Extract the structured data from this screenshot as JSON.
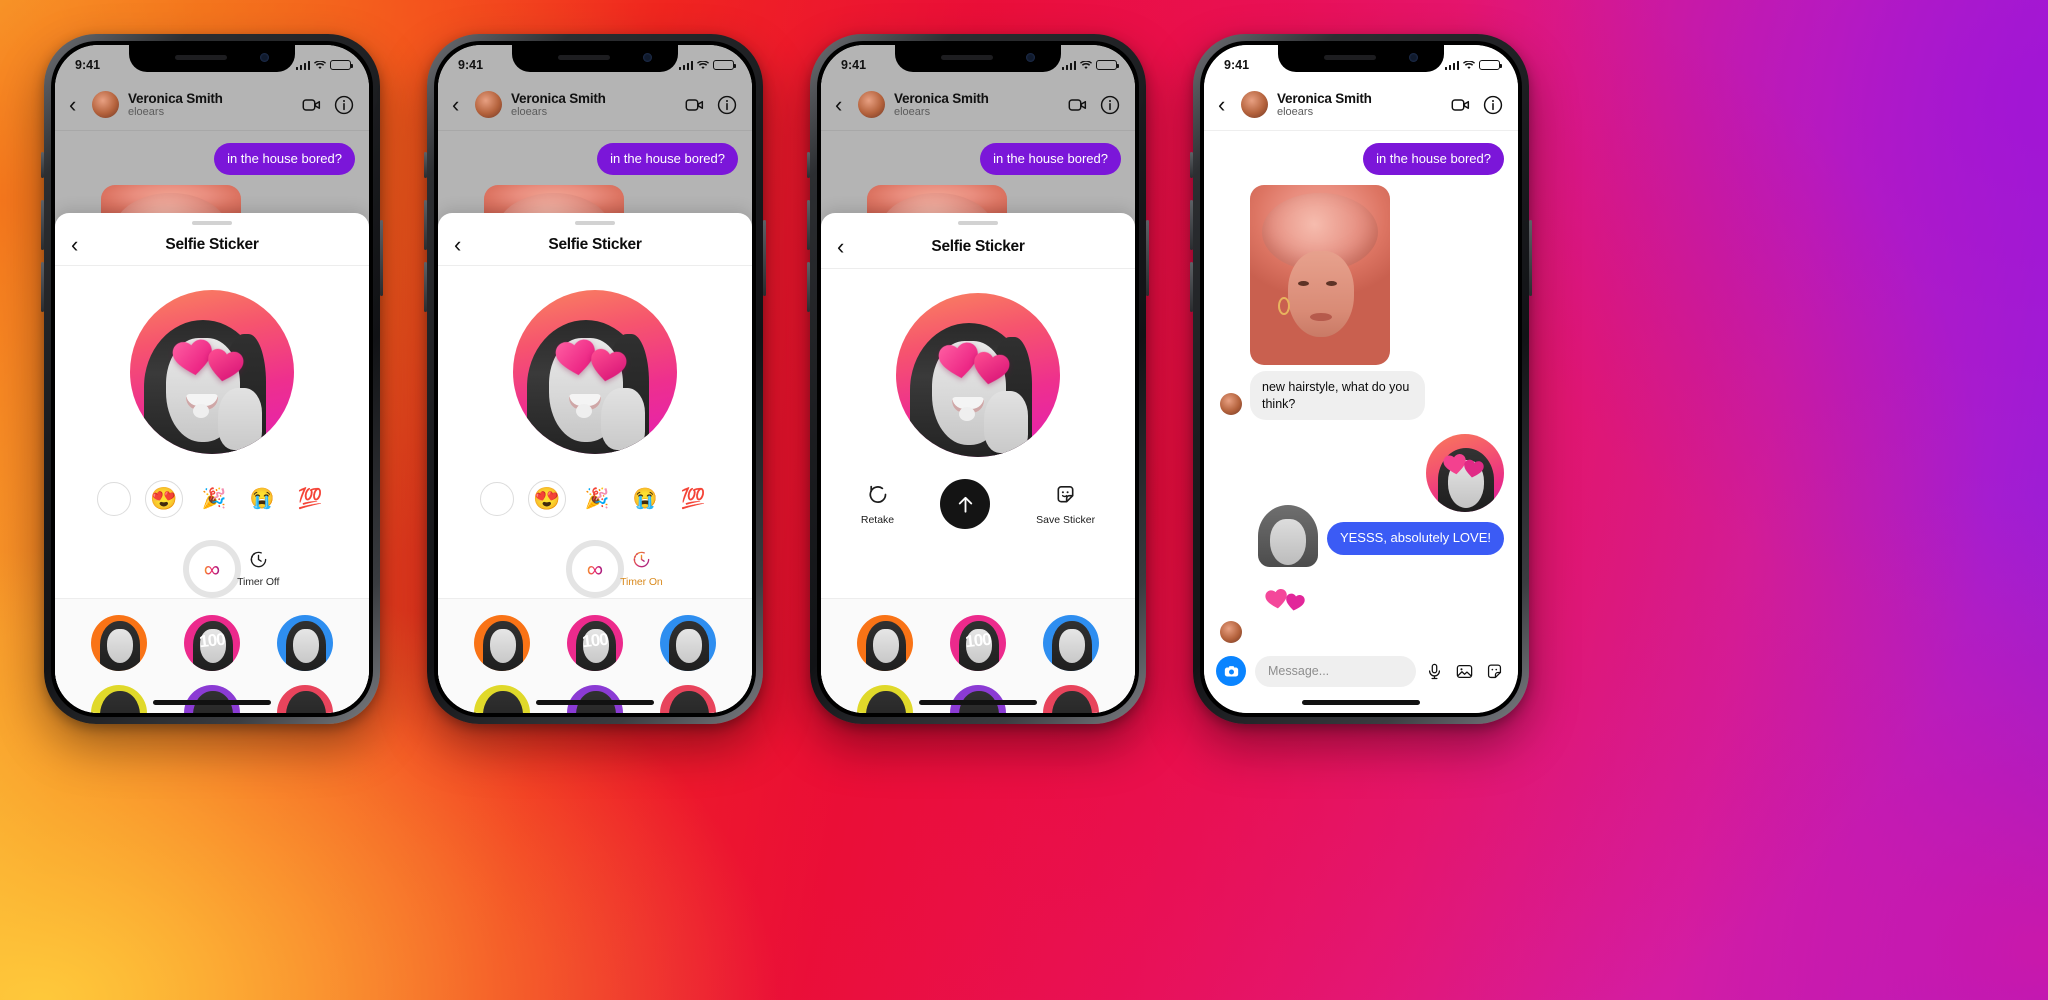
{
  "meta": {
    "screen_title": "Selfie Sticker",
    "status_time": "9:41"
  },
  "chat_header": {
    "name": "Veronica Smith",
    "username": "eloears",
    "back_icon": "chevron-left-icon",
    "video_icon": "video-camera-icon",
    "info_icon": "info-circle-icon"
  },
  "messages": {
    "outgoing_1": "in the house bored?",
    "incoming_text": "new hairstyle, what do you think?",
    "outgoing_2": "YESSS, absolutely LOVE!"
  },
  "sheet": {
    "title": "Selfie Sticker",
    "back_icon": "chevron-left-icon",
    "grab_handle": "drag-handle"
  },
  "emoji_options": [
    {
      "name": "none",
      "glyph": ""
    },
    {
      "name": "heart-eyes",
      "glyph": "😍"
    },
    {
      "name": "party-popper",
      "glyph": "🎉"
    },
    {
      "name": "loudly-crying",
      "glyph": "😭"
    },
    {
      "name": "hundred-points",
      "glyph": "💯"
    }
  ],
  "capture": {
    "shutter_glyph": "∞",
    "shutter_name": "loop-capture-button"
  },
  "timer": {
    "off_label": "Timer Off",
    "on_label": "Timer On",
    "icon": "timer-clock-icon",
    "on_color": "#d98a1e"
  },
  "actions": {
    "retake_label": "Retake",
    "retake_icon": "undo-arrow-icon",
    "send_icon": "arrow-up-icon",
    "save_label": "Save Sticker",
    "save_icon": "sticker-face-icon"
  },
  "tray": {
    "items": [
      {
        "name": "sticker-orange",
        "bg": "#f97316",
        "overlay": ""
      },
      {
        "name": "sticker-pink-100",
        "bg": "#ec2a8c",
        "overlay": "100"
      },
      {
        "name": "sticker-blue",
        "bg": "#2e8ef0",
        "overlay": ""
      }
    ],
    "peek_items": [
      {
        "name": "sticker-yellow",
        "bg": "#e0d92a"
      },
      {
        "name": "sticker-purple",
        "bg": "#8b3bd4"
      },
      {
        "name": "sticker-red",
        "bg": "#e8445c"
      }
    ]
  },
  "composer": {
    "placeholder": "Message...",
    "camera_icon": "camera-icon",
    "mic_icon": "microphone-icon",
    "gallery_icon": "photo-image-icon",
    "sticker_icon": "sticker-face-icon"
  },
  "colors": {
    "purple_bubble": "#7b16d9",
    "blue_bubble": "#3b5bf5",
    "accent_blue": "#0a84ff",
    "sheet_bg": "#ffffff",
    "chat_dim": "#b4b4b4"
  },
  "phones": [
    {
      "id": "phone-1",
      "state": "timer-off"
    },
    {
      "id": "phone-2",
      "state": "timer-on"
    },
    {
      "id": "phone-3",
      "state": "preview-actions"
    },
    {
      "id": "phone-4",
      "state": "conversation"
    }
  ]
}
